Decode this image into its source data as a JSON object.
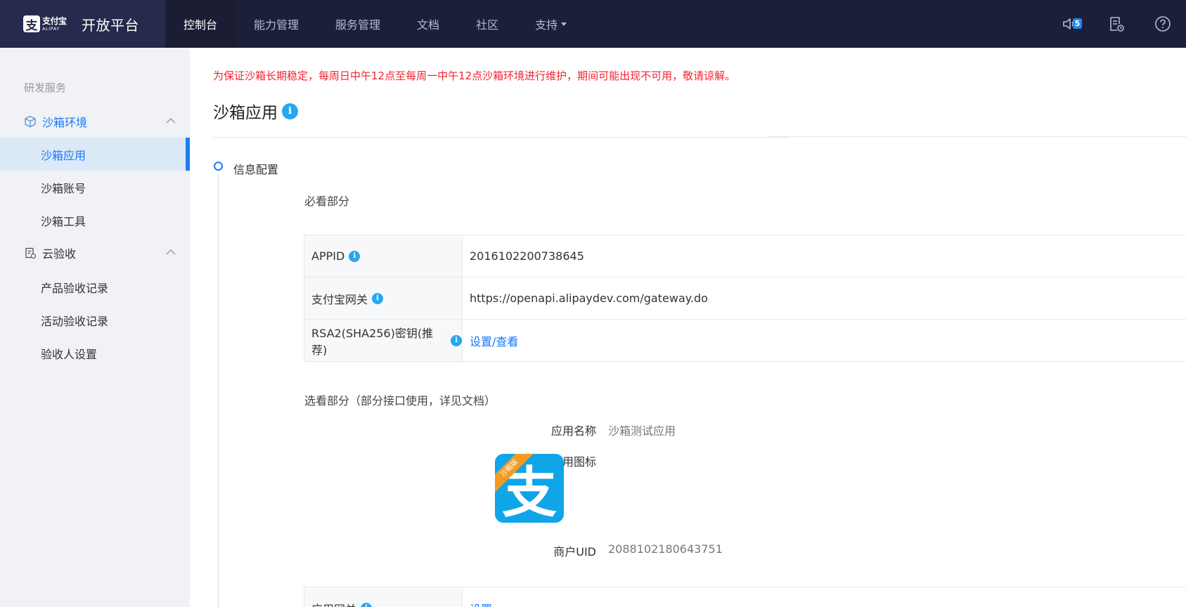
{
  "header": {
    "brand_cn": "支付宝",
    "brand_en": "ALIPAY",
    "platform_title": "开放平台",
    "nav": [
      {
        "label": "控制台"
      },
      {
        "label": "能力管理"
      },
      {
        "label": "服务管理"
      },
      {
        "label": "文档"
      },
      {
        "label": "社区"
      },
      {
        "label": "支持"
      }
    ],
    "notification_count": "5",
    "icons": [
      "speaker-icon",
      "document-icon",
      "help-icon"
    ]
  },
  "sidebar": {
    "section_title": "研发服务",
    "groups": [
      {
        "label": "沙箱环境",
        "icon": "cube-icon",
        "items": [
          "沙箱应用",
          "沙箱账号",
          "沙箱工具"
        ]
      },
      {
        "label": "云验收",
        "icon": "clipboard-icon",
        "items": [
          "产品验收记录",
          "活动验收记录",
          "验收人设置"
        ]
      }
    ],
    "active_item": "沙箱应用"
  },
  "main": {
    "notice": "为保证沙箱长期稳定，每周日中午12点至每周一中午12点沙箱环境进行维护，期间可能出现不可用，敬请谅解。",
    "page_title": "沙箱应用",
    "info_glyph": "i",
    "step_label": "信息配置",
    "required_heading": "必看部分",
    "required_rows": [
      {
        "key": "APPID",
        "value": "2016102200738645"
      },
      {
        "key": "支付宝网关",
        "value": "https://openapi.alipaydev.com/gateway.do"
      },
      {
        "key": "RSA2(SHA256)密钥(推荐)",
        "value": "设置/查看"
      }
    ],
    "optional_heading": "选看部分（部分接口使用，详见文档）",
    "app_name_label": "应用名称",
    "app_name_value": "沙箱测试应用",
    "app_icon_label": "应用图标",
    "app_icon_badge": "沙箱版",
    "app_icon_glyph": "支",
    "merchant_uid_label": "商户UID",
    "merchant_uid_value": "2088102180643751",
    "bottom_row": {
      "key": "应用网关",
      "value": "设置"
    }
  },
  "colors": {
    "topbar": "#1c1f38",
    "accent": "#1677ff",
    "notice": "#f5222d",
    "sidebar_bg": "#f0f2f5",
    "active_bg": "#dce9f7"
  }
}
